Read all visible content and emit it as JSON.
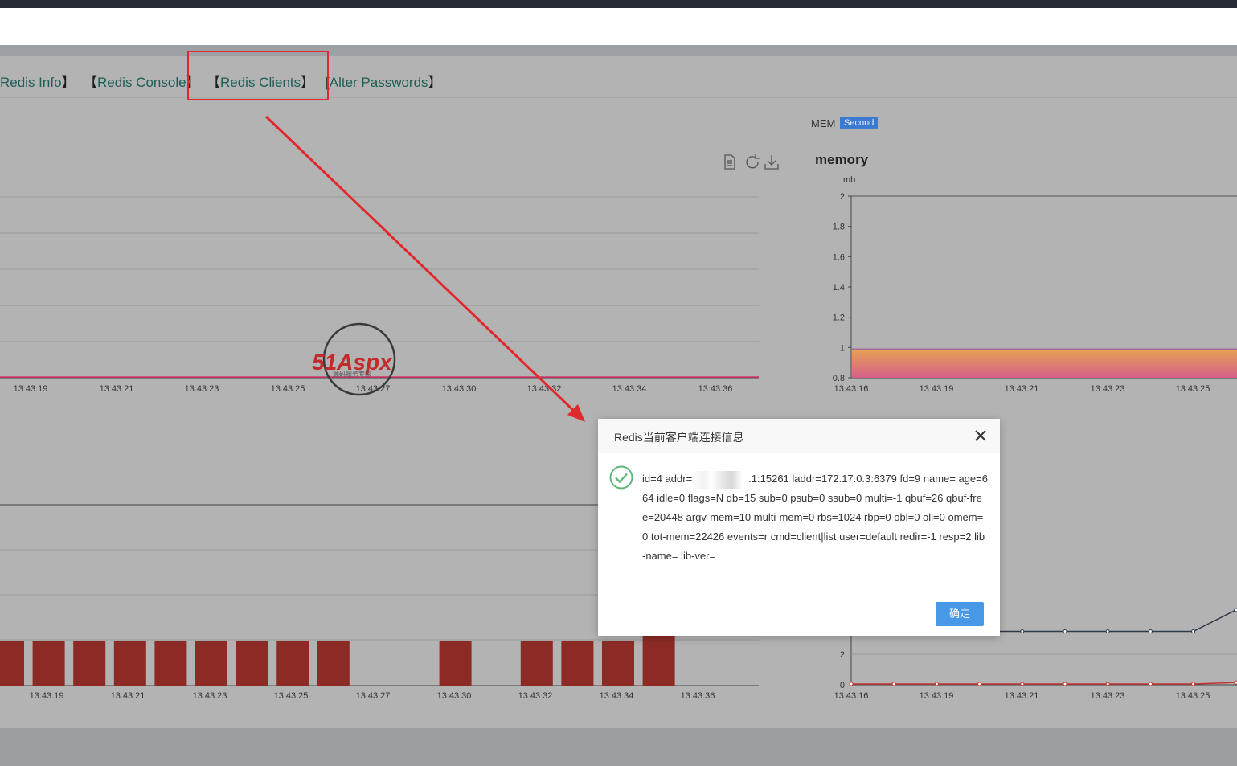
{
  "nav": {
    "items": [
      {
        "label": "Redis Info"
      },
      {
        "label": "Redis Console"
      },
      {
        "label": "Redis Clients"
      },
      {
        "label": "Alter Passwords"
      }
    ]
  },
  "mem_panel": {
    "label": "MEM",
    "badge": "Second"
  },
  "chart_data": [
    {
      "type": "line",
      "x": [
        "13:43:19",
        "13:43:21",
        "13:43:23",
        "13:43:25",
        "13:43:27",
        "13:43:30",
        "13:43:32",
        "13:43:34",
        "13:43:36"
      ],
      "series": [
        {
          "values": [
            0,
            0,
            0,
            0,
            0,
            0,
            0,
            0,
            0
          ]
        }
      ],
      "color": "#d8336a"
    },
    {
      "type": "area",
      "title": "memory",
      "ylabel": "mb",
      "ylim": [
        0.8,
        2
      ],
      "yticks": [
        "0.8",
        "1",
        "1.2",
        "1.4",
        "1.6",
        "1.8",
        "2"
      ],
      "x": [
        "13:43:16",
        "13:43:19",
        "13:43:21",
        "13:43:23",
        "13:43:25"
      ],
      "series": [
        {
          "values": [
            0.99,
            0.99,
            0.99,
            0.99,
            0.99
          ]
        }
      ],
      "color": "#e8a64e"
    },
    {
      "type": "bar",
      "x": [
        "13:43:19",
        "13:43:21",
        "13:43:23",
        "13:43:25",
        "13:43:27",
        "13:43:30",
        "13:43:32",
        "13:43:34",
        "13:43:36"
      ],
      "bars_present": [
        1,
        1,
        1,
        1,
        1,
        1,
        1,
        1,
        1,
        0,
        0,
        1,
        0,
        1,
        1,
        1,
        1
      ],
      "color": "#8c2b26"
    },
    {
      "type": "line",
      "x": [
        "13:43:16",
        "13:43:19",
        "13:43:21",
        "13:43:23",
        "13:43:25"
      ],
      "yticks": [
        "0",
        "2"
      ],
      "series": [
        {
          "values": [
            3.5,
            3.5,
            3.5,
            3.5,
            3.5,
            3.5,
            3.5,
            3.5,
            3.5,
            4.9
          ],
          "color": "#2c3a4a"
        },
        {
          "values": [
            0.05,
            0.05,
            0.05,
            0.05,
            0.05,
            0.05,
            0.05,
            0.05,
            0.05,
            0.15
          ],
          "color": "#c23531"
        }
      ]
    }
  ],
  "dialog": {
    "title": "Redis当前客户端连接信息",
    "body_prefix": "id=4 addr=",
    "body_suffix": ".1:15261 laddr=172.17.0.3:6379 fd=9 name= age=664 idle=0 flags=N db=15 sub=0 psub=0 ssub=0 multi=-1 qbuf=26 qbuf-free=20448 argv-mem=10 multi-mem=0 rbs=1024 rbp=0 obl=0 oll=0 omem=0 tot-mem=22426 events=r cmd=client|list user=default redir=-1 resp=2 lib-name= lib-ver=",
    "confirm_label": "确定",
    "colors": {
      "accent": "#4898e8",
      "success": "#5fb878"
    }
  },
  "watermark": {
    "main": "51Aspx",
    "sub": "源码服务专家"
  },
  "icons": [
    "data-view-icon",
    "refresh-icon",
    "download-icon",
    "close-icon",
    "check-circle-icon",
    "arrow-annotation"
  ]
}
